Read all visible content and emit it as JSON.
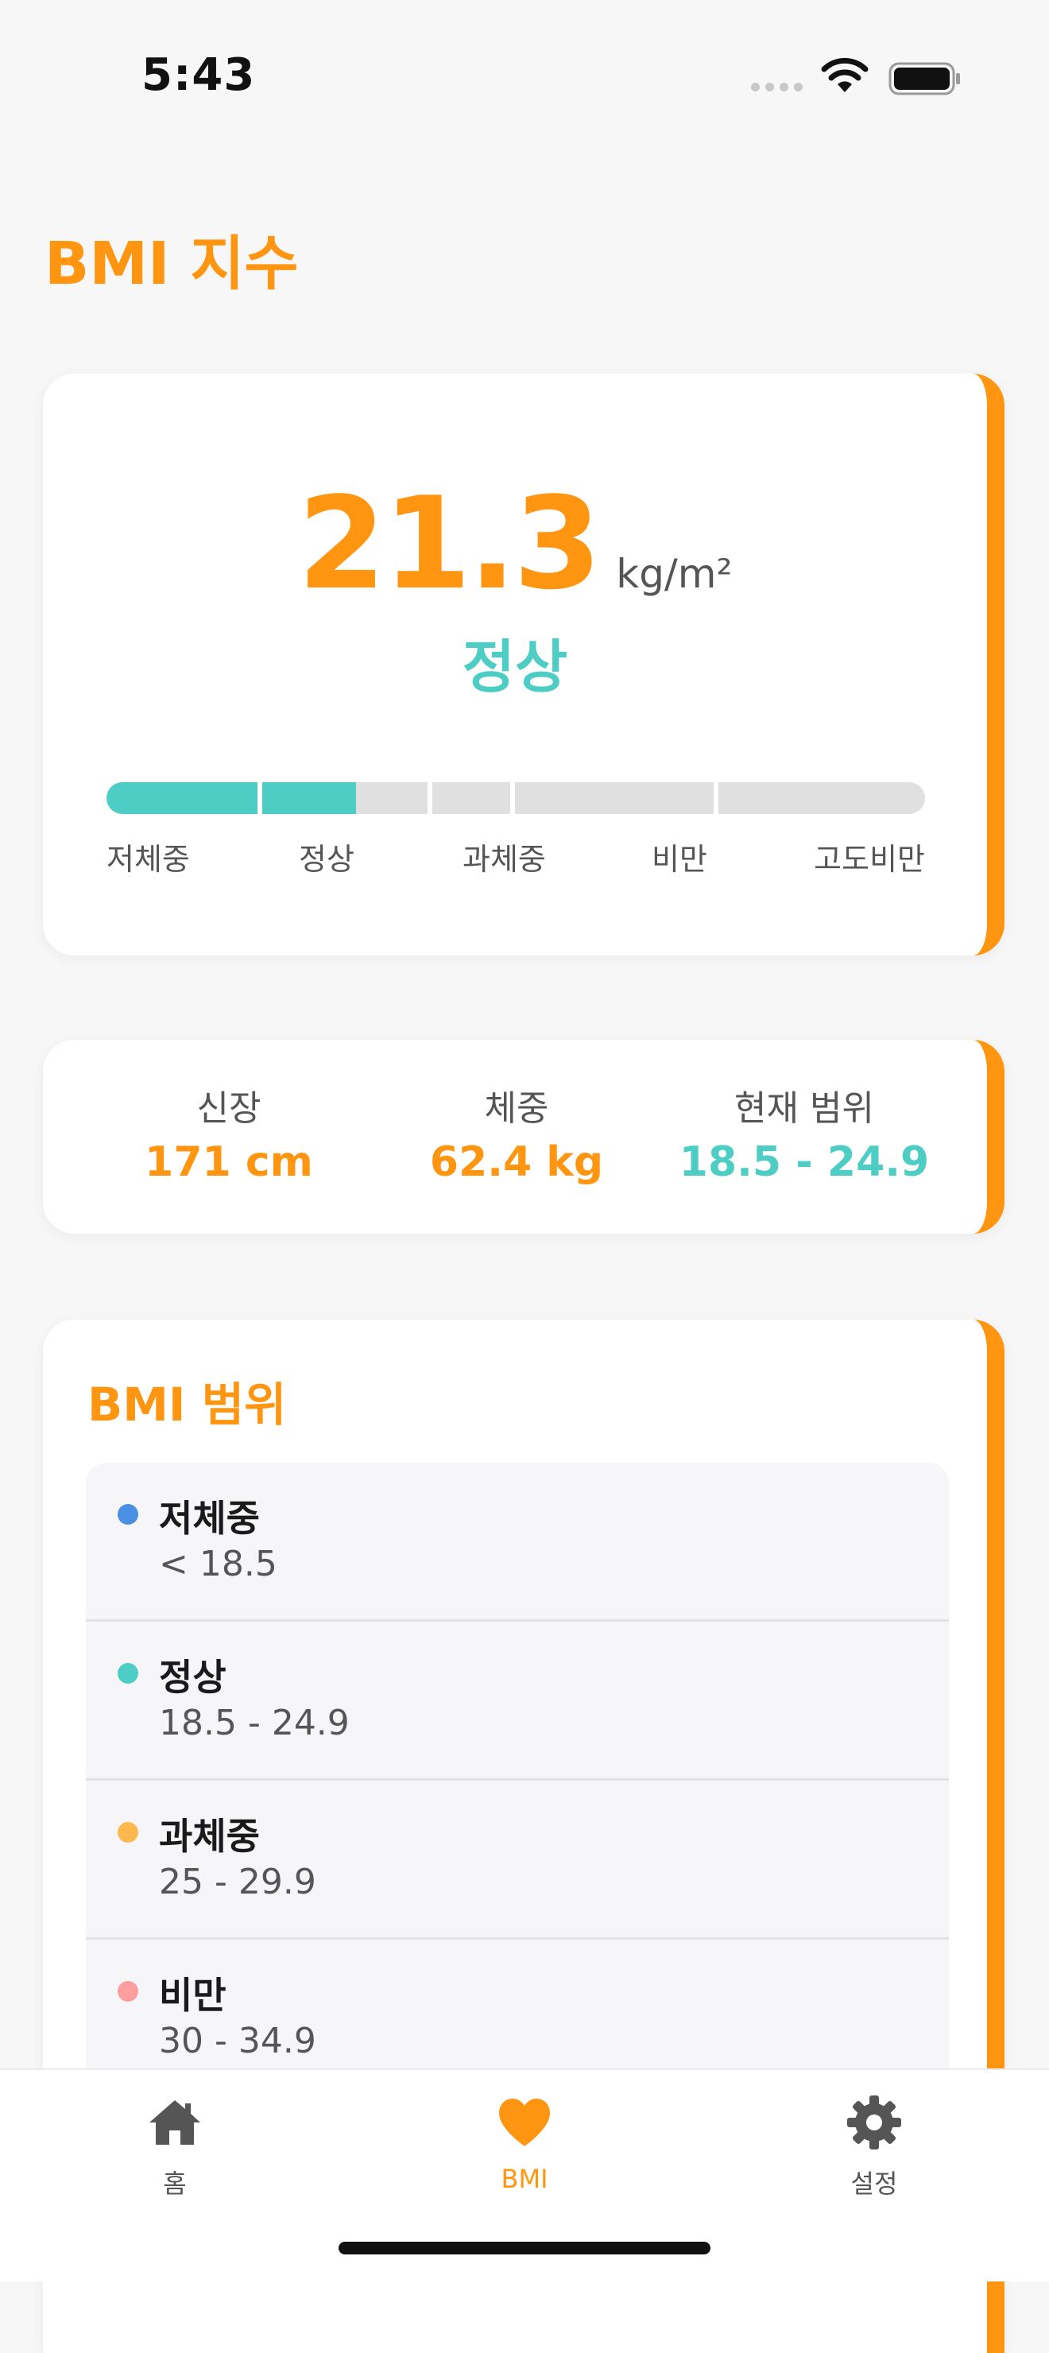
{
  "status_bar": {
    "time": "5:43"
  },
  "header": {
    "title": "BMI 지수"
  },
  "bmi": {
    "value": "21.3",
    "unit": "kg/m²",
    "status": "정상",
    "scale_labels": [
      "저체중",
      "정상",
      "과체중",
      "비만",
      "고도비만"
    ],
    "progress_fraction": 0.31
  },
  "stats": [
    {
      "label": "신장",
      "value": "171 cm"
    },
    {
      "label": "체중",
      "value": "62.4 kg"
    },
    {
      "label": "현재 범위",
      "value": "18.5 - 24.9"
    }
  ],
  "ranges": {
    "title": "BMI 범위",
    "items": [
      {
        "name": "저체중",
        "range": "< 18.5",
        "color": "#4a90e2"
      },
      {
        "name": "정상",
        "range": "18.5 - 24.9",
        "color": "#4ecdc4"
      },
      {
        "name": "과체중",
        "range": "25 - 29.9",
        "color": "#ffb84d"
      },
      {
        "name": "비만",
        "range": "30 - 34.9",
        "color": "#ff9e9e"
      }
    ]
  },
  "tabs": [
    {
      "label": "홈",
      "icon": "home-icon",
      "active": false
    },
    {
      "label": "BMI",
      "icon": "heart-icon",
      "active": true
    },
    {
      "label": "설정",
      "icon": "gear-icon",
      "active": false
    }
  ],
  "colors": {
    "accent": "#ff9510",
    "normal": "#4ecdc4",
    "track": "#e0e0e0"
  }
}
